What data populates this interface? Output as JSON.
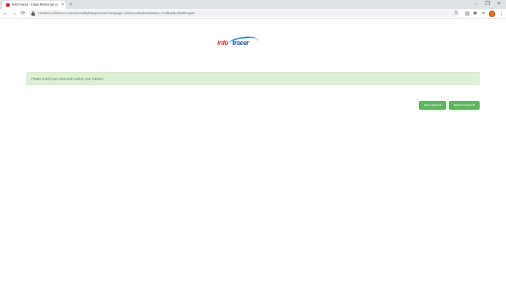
{
  "browser": {
    "tab_title": "InfoTracer - Data Removal your...",
    "tab_close": "×",
    "new_tab": "+",
    "window_controls": {
      "minimize": "–",
      "maximize": "❐",
      "close": "×"
    },
    "nav": {
      "back": "←",
      "forward": "→",
      "reload": "⟳"
    },
    "url": "members.infotracer.com/removeMyData/process?campaign=InfotracerSystem&status=CAll&optoutSWProgstsi",
    "icons": [
      "key-icon",
      "page-icon",
      "extensions-icon",
      "media-icon",
      "profile-avatar",
      "menu-icon"
    ]
  },
  "page": {
    "logo": {
      "part1": "info",
      "part2": "tracer",
      "tm": "®"
    },
    "alert_message": "Please check your email and confirm your request!",
    "buttons": {
      "new_search": "New Search",
      "back_to_result": "Back to Result"
    }
  },
  "colors": {
    "alert_bg": "#dff0d8",
    "alert_text": "#3c763d",
    "button_green": "#5cb85c",
    "logo_red": "#d32f2f",
    "logo_blue": "#1a4f9c"
  }
}
